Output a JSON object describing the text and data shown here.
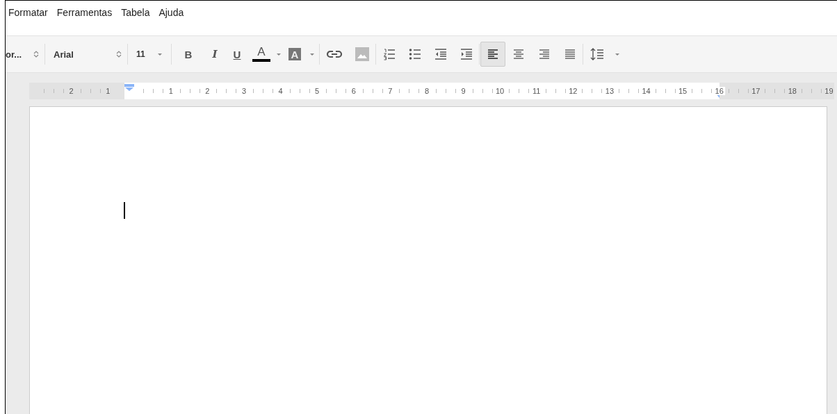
{
  "menu": [
    {
      "label": "Formatar"
    },
    {
      "label": "Ferramentas"
    },
    {
      "label": "Tabela"
    },
    {
      "label": "Ajuda"
    }
  ],
  "toolbar": {
    "style": "or...",
    "font": "Arial",
    "size": "11",
    "format": [
      {
        "kind": "bold",
        "glyph": "B"
      },
      {
        "kind": "italic",
        "glyph": "I"
      },
      {
        "kind": "underline",
        "glyph": "U"
      }
    ],
    "text_color": {
      "glyph": "A",
      "color": "#000000"
    },
    "highlight": {
      "glyph": "A"
    },
    "align": [
      {
        "kind": "left",
        "selected": true
      },
      {
        "kind": "center",
        "selected": false
      },
      {
        "kind": "right",
        "selected": false
      },
      {
        "kind": "justify",
        "selected": false
      }
    ]
  },
  "ruler": {
    "left_labels": [
      "2",
      "1"
    ],
    "labels": [
      "1",
      "2",
      "3",
      "4",
      "5",
      "6",
      "7",
      "8",
      "9",
      "10",
      "11",
      "12",
      "13",
      "14",
      "15",
      "16"
    ],
    "right_labels": [
      "17",
      "18",
      "19"
    ]
  }
}
